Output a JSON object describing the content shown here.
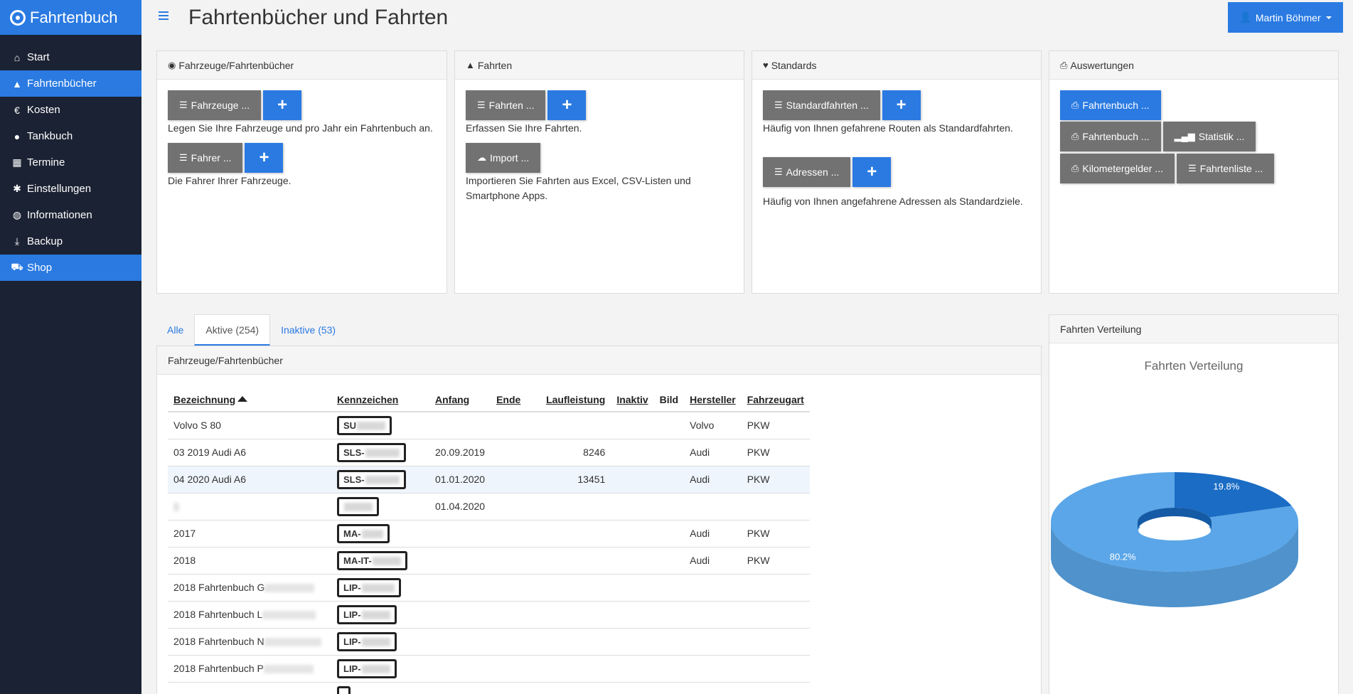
{
  "brand": "Fahrtenbuch",
  "page_title": "Fahrtenbücher und Fahrten",
  "user_name": "Martin Böhmer",
  "nav": [
    {
      "label": "Start",
      "icon": "home-icon",
      "glyph": "⌂"
    },
    {
      "label": "Fahrtenbücher",
      "icon": "road-icon",
      "glyph": "▲"
    },
    {
      "label": "Kosten",
      "icon": "euro-icon",
      "glyph": "€"
    },
    {
      "label": "Tankbuch",
      "icon": "tint-icon",
      "glyph": "●"
    },
    {
      "label": "Termine",
      "icon": "calendar-icon",
      "glyph": "▦"
    },
    {
      "label": "Einstellungen",
      "icon": "gear-icon",
      "glyph": "✱"
    },
    {
      "label": "Informationen",
      "icon": "globe-icon",
      "glyph": "◍"
    },
    {
      "label": "Backup",
      "icon": "download-icon",
      "glyph": "⤓"
    },
    {
      "label": "Shop",
      "icon": "cart-icon",
      "glyph": "⛟"
    }
  ],
  "panels": {
    "vehicles": {
      "title": "Fahrzeuge/Fahrtenbücher",
      "btn_vehicles": "Fahrzeuge ...",
      "desc_vehicles": "Legen Sie Ihre Fahrzeuge und pro Jahr ein Fahrtenbuch an.",
      "btn_drivers": "Fahrer ...",
      "desc_drivers": "Die Fahrer Ihrer Fahrzeuge."
    },
    "trips": {
      "title": "Fahrten",
      "btn_trips": "Fahrten ...",
      "desc_trips": "Erfassen Sie Ihre Fahrten.",
      "btn_import": "Import ...",
      "desc_import": "Importieren Sie Fahrten aus Excel, CSV-Listen und Smartphone Apps."
    },
    "standards": {
      "title": "Standards",
      "btn_routes": "Standardfahrten ...",
      "desc_routes": "Häufig von Ihnen gefahrene Routen als Standardfahrten.",
      "btn_addresses": "Adressen ...",
      "desc_addresses": "Häufig von Ihnen angefahrene Adressen als Standardziele."
    },
    "reports": {
      "title": "Auswertungen",
      "btn_logbook_primary": "Fahrtenbuch ...",
      "btn_logbook": "Fahrtenbuch ...",
      "btn_stats": "Statistik ...",
      "btn_mileage": "Kilometergelder ...",
      "btn_triplist": "Fahrtenliste ..."
    }
  },
  "tabs": [
    "Alle",
    "Aktive (254)",
    "Inaktive (53)"
  ],
  "table_panel_title": "Fahrzeuge/Fahrtenbücher",
  "table": {
    "headers": [
      "Bezeichnung",
      "Kennzeichen",
      "Anfang",
      "Ende",
      "Laufleistung",
      "Inaktiv",
      "Bild",
      "Hersteller",
      "Fahrzeugart"
    ],
    "rows": [
      {
        "name": "Volvo S 80",
        "plate": "SU",
        "start": "",
        "end": "",
        "mileage": "",
        "maker": "Volvo",
        "kind": "PKW"
      },
      {
        "name": "03 2019 Audi A6",
        "plate": "SLS-",
        "start": "20.09.2019",
        "end": "",
        "mileage": "8246",
        "maker": "Audi",
        "kind": "PKW"
      },
      {
        "name": "04 2020 Audi A6",
        "plate": "SLS-",
        "start": "01.01.2020",
        "end": "",
        "mileage": "13451",
        "maker": "Audi",
        "kind": "PKW"
      },
      {
        "name": "",
        "plate": "",
        "start": "01.04.2020",
        "end": "",
        "mileage": "",
        "maker": "",
        "kind": ""
      },
      {
        "name": "2017",
        "plate": "MA-",
        "start": "",
        "end": "",
        "mileage": "",
        "maker": "Audi",
        "kind": "PKW"
      },
      {
        "name": "2018",
        "plate": "MA-IT-",
        "start": "",
        "end": "",
        "mileage": "",
        "maker": "Audi",
        "kind": "PKW"
      },
      {
        "name": "2018 Fahrtenbuch G",
        "plate": "LIP-",
        "start": "",
        "end": "",
        "mileage": "",
        "maker": "",
        "kind": ""
      },
      {
        "name": "2018 Fahrtenbuch L",
        "plate": "LIP-",
        "start": "",
        "end": "",
        "mileage": "",
        "maker": "",
        "kind": ""
      },
      {
        "name": "2018 Fahrtenbuch N",
        "plate": "LIP-",
        "start": "",
        "end": "",
        "mileage": "",
        "maker": "",
        "kind": ""
      },
      {
        "name": "2018 Fahrtenbuch P",
        "plate": "LIP-",
        "start": "",
        "end": "",
        "mileage": "",
        "maker": "",
        "kind": ""
      },
      {
        "name": "",
        "plate": "",
        "start": "",
        "end": "",
        "mileage": "",
        "maker": "",
        "kind": ""
      }
    ]
  },
  "chart_panel_title": "Fahrten Verteilung",
  "chart_data": {
    "type": "pie",
    "title": "Fahrten Verteilung",
    "slices": [
      {
        "value": 19.8,
        "label": "19.8%",
        "color": "#1a6cc4"
      },
      {
        "value": 80.2,
        "label": "80.2%",
        "color": "#5aa6e8"
      }
    ]
  },
  "colors": {
    "accent": "#2a7ae2",
    "sidebar": "#1b2233",
    "button_gray": "#727272"
  }
}
